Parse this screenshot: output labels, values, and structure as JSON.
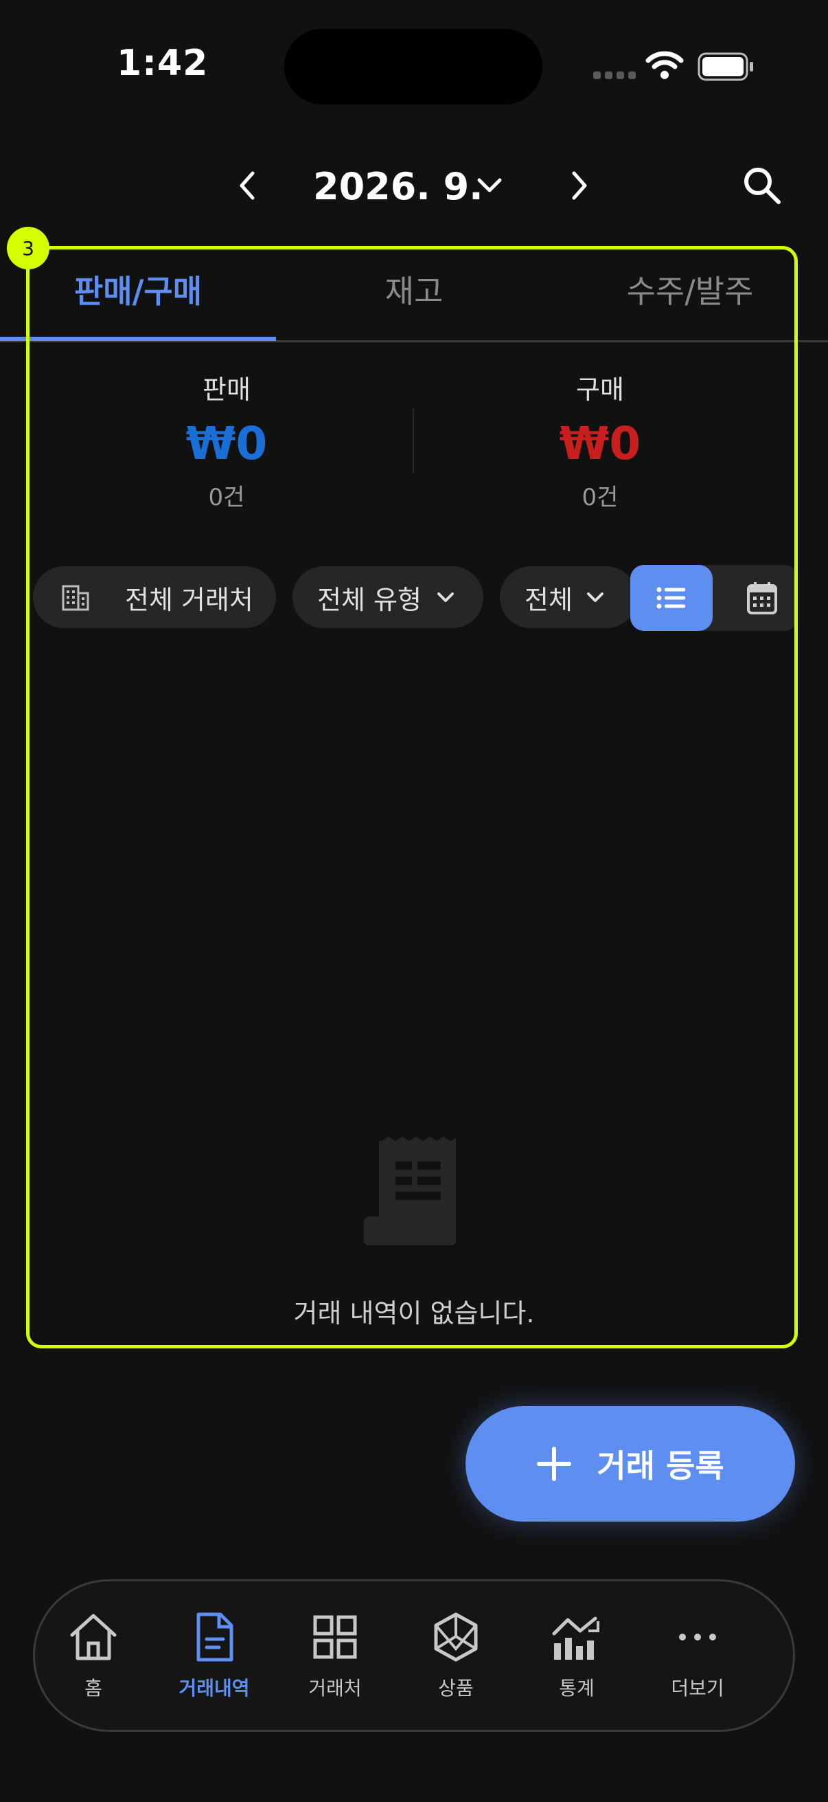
{
  "status_bar": {
    "time": "1:42"
  },
  "header": {
    "month_title": "2026. 9.",
    "icons": {
      "prev": "chevron-left-icon",
      "next": "chevron-right-icon",
      "dropdown": "chevron-down-icon",
      "search": "search-icon"
    }
  },
  "focus_badge": "3",
  "tabs": [
    {
      "label": "판매/구매",
      "active": true
    },
    {
      "label": "재고",
      "active": false
    },
    {
      "label": "수주/발주",
      "active": false
    }
  ],
  "summary": {
    "sales": {
      "label": "판매",
      "amount": "₩0",
      "count": "0건",
      "color": "#1a6fd6"
    },
    "purchase": {
      "label": "구매",
      "amount": "₩0",
      "count": "0건",
      "color": "#c81e1e"
    }
  },
  "filters": {
    "partner": "전체 거래처",
    "type": "전체 유형",
    "status": "전체"
  },
  "view_toggle": {
    "selected": "list",
    "icons": [
      "list-icon",
      "calendar-icon"
    ]
  },
  "empty_state": {
    "message": "거래 내역이 없습니다."
  },
  "fab": {
    "label": "거래 등록"
  },
  "bottom_nav": {
    "items": [
      {
        "label": "홈",
        "icon": "home-icon",
        "active": false
      },
      {
        "label": "거래내역",
        "icon": "document-icon",
        "active": true
      },
      {
        "label": "거래처",
        "icon": "grid-icon",
        "active": false
      },
      {
        "label": "상품",
        "icon": "cube-icon",
        "active": false
      },
      {
        "label": "통계",
        "icon": "chart-icon",
        "active": false
      },
      {
        "label": "더보기",
        "icon": "more-icon",
        "active": false
      }
    ]
  },
  "colors": {
    "accent": "#5e8ef0",
    "highlight": "#d4ff00",
    "background": "#111111"
  }
}
